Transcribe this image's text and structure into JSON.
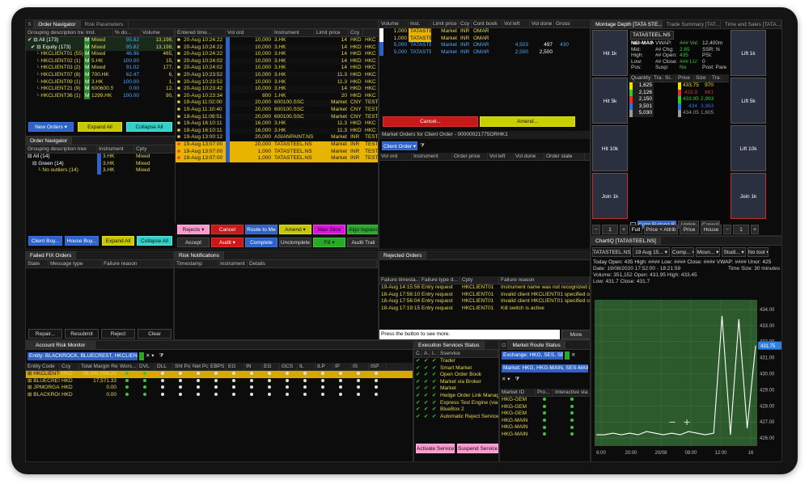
{
  "order_navigator": {
    "tabs": [
      "Order Navigator",
      "Risk Parameters"
    ],
    "tree_headers": [
      "Grouping description tree",
      "Inst.",
      "% do...",
      "Volume"
    ],
    "tree_rows": [
      {
        "label": "All (173)",
        "inst": "Mixed",
        "pct": "95.82",
        "vol": "13,198,"
      },
      {
        "label": "Equity (173)",
        "inst": "Mixed",
        "pct": "95.82",
        "vol": "13,198,"
      },
      {
        "label": "HKCLIENT01 (55)",
        "inst": "Mixed",
        "pct": "46.96",
        "vol": "465,"
      },
      {
        "label": "HKCLIENT02 (1)",
        "inst": "5.HK",
        "pct": "100.00",
        "vol": "15,"
      },
      {
        "label": "HKCLIENT03 (2)",
        "inst": "Mixed",
        "pct": "91.02",
        "vol": "177,"
      },
      {
        "label": "HKCLIENT07 (8)",
        "inst": "700.HK",
        "pct": "62.47",
        "vol": "6,"
      },
      {
        "label": "HKCLIENT09 (1)",
        "inst": "3.HK",
        "pct": "100.00",
        "vol": "1,"
      },
      {
        "label": "HKCLIENT21 (9)",
        "inst": "600600.SSC",
        "pct": "0.00",
        "vol": "12,"
      },
      {
        "label": "HKCLIENT36 (1)",
        "inst": "1299.HK",
        "pct": "100.00",
        "vol": "90,"
      }
    ],
    "order_headers": [
      "Entered time...",
      "Vol ord",
      "Instrument",
      "Limit price",
      "Ccy",
      ""
    ],
    "orders": [
      {
        "time": "20-Aug 10:24:22",
        "vol": "10,000",
        "inst": "3.HK",
        "price": "14",
        "ccy": "HKD",
        "x": "HKC",
        "tc": "#e6d84a",
        "hl": false
      },
      {
        "time": "20-Aug 10:24:22",
        "vol": "10,000",
        "inst": "3.HK",
        "price": "14",
        "ccy": "HKD",
        "x": "HKC",
        "tc": "#e6d84a",
        "hl": false
      },
      {
        "time": "20-Aug 10:24:22",
        "vol": "10,000",
        "inst": "3.HK",
        "price": "14",
        "ccy": "HKD",
        "x": "HKC",
        "tc": "#e6d84a",
        "hl": false
      },
      {
        "time": "20-Aug 10:24:02",
        "vol": "10,000",
        "inst": "3.HK",
        "price": "14",
        "ccy": "HKD",
        "x": "HKC",
        "tc": "#e6d84a",
        "hl": false
      },
      {
        "time": "20-Aug 10:24:02",
        "vol": "10,000",
        "inst": "3.HK",
        "price": "14",
        "ccy": "HKD",
        "x": "HKC",
        "tc": "#e6d84a",
        "hl": false
      },
      {
        "time": "20-Aug 10:23:52",
        "vol": "10,000",
        "inst": "3.HK",
        "price": "11.3",
        "ccy": "HKD",
        "x": "HKC",
        "tc": "#e6d84a",
        "hl": false
      },
      {
        "time": "20-Aug 10:23:52",
        "vol": "10,000",
        "inst": "3.HK",
        "price": "11.3",
        "ccy": "HKD",
        "x": "HKC",
        "tc": "#e6d84a",
        "hl": false
      },
      {
        "time": "20-Aug 10:23:42",
        "vol": "10,000",
        "inst": "3.HK",
        "price": "14",
        "ccy": "HKD",
        "x": "HKC",
        "tc": "#e6d84a",
        "hl": false
      },
      {
        "time": "20-Aug 10:23:34",
        "vol": "800",
        "inst": "1.HK",
        "price": "20",
        "ccy": "HKD",
        "x": "HKC",
        "tc": "#e6d84a",
        "hl": false
      },
      {
        "time": "19-Aug 11:02:00",
        "vol": "20,000",
        "inst": "600100.SSC",
        "price": "Market",
        "ccy": "CNY",
        "x": "TEST",
        "tc": "#e6d84a",
        "hl": false
      },
      {
        "time": "19-Aug 11:10:40",
        "vol": "20,000",
        "inst": "600100.SSC",
        "price": "Market",
        "ccy": "CNY",
        "x": "TEST",
        "tc": "#e6d84a",
        "hl": false
      },
      {
        "time": "19-Aug 11:09:51",
        "vol": "20,000",
        "inst": "600100.SSC",
        "price": "Market",
        "ccy": "CNY",
        "x": "TEST",
        "tc": "#e6d84a",
        "hl": false
      },
      {
        "time": "19-Aug 16:10:11",
        "vol": "16,000",
        "inst": "3.HK",
        "price": "11.3",
        "ccy": "HKD",
        "x": "HKC",
        "tc": "#e6d84a",
        "hl": false
      },
      {
        "time": "19-Aug 16:10:11",
        "vol": "16,000",
        "inst": "3.HK",
        "price": "11.3",
        "ccy": "HKD",
        "x": "HKC",
        "tc": "#e6d84a",
        "hl": false
      },
      {
        "time": "19-Aug 13:00:12",
        "vol": "20,000",
        "inst": "ASIANPAINT.NS",
        "price": "Market",
        "ccy": "INR",
        "x": "TEST",
        "tc": "#e6d84a",
        "hl": false
      },
      {
        "time": "19-Aug 13:07:00",
        "vol": "20,000",
        "inst": "TATASTEEL.NS",
        "price": "Market",
        "ccy": "INR",
        "x": "TEST",
        "tc": "#ffffff",
        "hl": true
      },
      {
        "time": "19-Aug 13:07:00",
        "vol": "1,000",
        "inst": "TATASTEEL.NS",
        "price": "Market",
        "ccy": "INR",
        "x": "TEST",
        "tc": "#ffffff",
        "hl": true
      },
      {
        "time": "19-Aug 13:07:00",
        "vol": "1,000",
        "inst": "TATASTEEL.NS",
        "price": "Market",
        "ccy": "INR",
        "x": "TEST",
        "tc": "#ffffff",
        "hl": true
      }
    ],
    "buttons": {
      "new_orders": "New Orders",
      "expand_all": "Expand All",
      "collapse_all": "Collapse All"
    },
    "actions_row1": [
      "Rejects",
      "Cancel",
      "Route to Me",
      "Amend",
      "Man Slice",
      "Algo bypass"
    ],
    "actions_row2": [
      "Accept",
      "Audit",
      "Complete",
      "Unclomplete",
      "Fill",
      "Audit Trail"
    ]
  },
  "order_navigator_2": {
    "tab": "Order Navigator",
    "headers": [
      "Grouping description tree",
      "Instrument",
      "Cpty"
    ],
    "rows": [
      {
        "label": "All (14)",
        "inst": "3.HK",
        "cpty": "Mixed"
      },
      {
        "label": "Green (14)",
        "inst": "3.HK",
        "cpty": "Mixed"
      },
      {
        "label": "No outliers (14)",
        "inst": "3.HK",
        "cpty": "Mixed"
      }
    ],
    "buttons": [
      "Client Buy...",
      "House Buy...",
      "Expand All",
      "Collapse All"
    ]
  },
  "market_orders": {
    "headers": [
      "Volume",
      "Inst.",
      "Limit price",
      "Ccy",
      "Cont book",
      "Vol left",
      "Vol done",
      "Gross"
    ],
    "rows": [
      {
        "vol": "1,000",
        "inst": "TATASTEEL",
        "price": "Market",
        "ccy": "INR",
        "book": "OMAR",
        "left": "",
        "done": "",
        "gross": ""
      },
      {
        "vol": "1,000",
        "inst": "TATASTEEL",
        "price": "Market",
        "ccy": "INR",
        "book": "OMAR",
        "left": "",
        "done": "",
        "gross": ""
      },
      {
        "vol": "5,000",
        "inst": "TATASTEEL",
        "price": "Market",
        "ccy": "INR",
        "book": "OMAR",
        "left": "4,503",
        "done": "497",
        "gross": "430"
      },
      {
        "vol": "5,000",
        "inst": "TATASTEEL",
        "price": "Market",
        "ccy": "INR",
        "book": "OMAR",
        "left": "2,500",
        "done": "2,500",
        "gross": ""
      }
    ],
    "cancel": "Cancel...",
    "amend": "Amend...",
    "client_title": "Market Orders for Client Order - 00000021775ORHK1",
    "client_order": "Client Order",
    "client_headers": [
      "Vol ord",
      "Instrument",
      "Order price",
      "Vol left",
      "Vol done",
      "Order state"
    ]
  },
  "failed_fix": {
    "tab": "Failed FIX Orders",
    "headers": [
      "State",
      "Message type",
      "Failure reason"
    ],
    "buttons": [
      "Repair...",
      "Resubmit",
      "Reject",
      "Clear"
    ]
  },
  "risk_notifications": {
    "tab": "Risk Notifications",
    "headers": [
      "Timestamp",
      "Instrument",
      "Details"
    ]
  },
  "rejected_orders": {
    "tab": "Rejected Orders",
    "headers": [
      "Failure timesta...",
      "Failure type d...",
      "Cpty",
      "Failure reason"
    ],
    "rows": [
      {
        "time": "19-Aug 14:15:56",
        "type": "Entry request",
        "cpty": "HKCLIENT01",
        "reason": "Instrument name was not recognized (no I"
      },
      {
        "time": "18-Aug 17:56:10",
        "type": "Entry request",
        "cpty": "HKCLIENT01",
        "reason": "Invalid client HKCLIENT01 specified on risk"
      },
      {
        "time": "18-Aug 17:56:04",
        "type": "Entry request",
        "cpty": "HKCLIENT01",
        "reason": "Invalid client HKCLIENT01 specified on risk"
      },
      {
        "time": "18-Aug 17:19:15",
        "type": "Entry request",
        "cpty": "HKCLIENT01",
        "reason": "Kill switch is active"
      }
    ],
    "footer": "Press the button to see more.",
    "more": "More"
  },
  "account_risk": {
    "tab": "Account Risk Monitor",
    "filter": "Entity: BLACKROCK, BLUECREST, HKCLIENT01, JPM...",
    "headers": [
      "Entity Code",
      "Ccy",
      "Total Margin Req",
      "Wors...",
      "DVL",
      "DLL",
      "Sht Pos",
      "Net Pos",
      "EBPS",
      "EG",
      "IN",
      "EG",
      "GCS",
      "IL",
      "ILP",
      "IP",
      "IS",
      "ISP"
    ],
    "rows": [
      {
        "code": "HKCLIENT01",
        "ccy": "HKD",
        "margin": "36,391,056.26"
      },
      {
        "code": "BLUECREST",
        "ccy": "HKD",
        "margin": "17,571.33"
      },
      {
        "code": "JPMORGAN",
        "ccy": "HKD",
        "margin": "0.00"
      },
      {
        "code": "BLACKROCK",
        "ccy": "HKD",
        "margin": "0.00"
      }
    ]
  },
  "exec_services": {
    "tab": "Execution Services Status",
    "headers": [
      "C..",
      "A..",
      "I..",
      "Sservice"
    ],
    "rows": [
      "Trader",
      "Smart Market",
      "Open Order Book",
      "Market via Broker",
      "Market",
      "Hedge Order Link Manag",
      "Express Test Engine (via )",
      "BlueBox 2",
      "Automatic Reject Service"
    ],
    "buttons": [
      "Activate Service",
      "Suspend Service"
    ]
  },
  "market_route": {
    "tab": "Market Route Status",
    "exchange": "Exchange: HKG, SES, SET",
    "market": "Market: HKG, HKG-MAIN, SES-MAIN, S...",
    "headers": [
      "Market ID",
      "Pro...",
      "Interactive sta"
    ],
    "rows": [
      "HKG-GEM",
      "HKG-GEM",
      "HKG-GEM",
      "HKG-MAIN",
      "HKG-MAIN",
      "HKG-MAIN"
    ]
  },
  "montage": {
    "tabs": [
      "Montage Depth [TATA STE...",
      "Trade Summary [TAT...",
      "Time and Sales [TATA..."
    ],
    "hit_buttons": [
      "Hit 1k",
      "Hit 5k",
      "Hit 10k",
      "Join 1k"
    ],
    "lift_buttons": [
      "Lift 1k",
      "Lift 5k",
      "Lift 10k",
      "Join 1k"
    ],
    "symbol": "TATASTEEL.NS",
    "venue": "NSI-MAIN",
    "quote_lines": [
      [
        "NSI-MAIN",
        "VWAP:",
        "### Vol:",
        "12,400m"
      ],
      [
        "Mid:",
        "## Chg:",
        "2.65",
        "SSR: N"
      ],
      [
        "High:",
        "## Open:",
        "435",
        "PSI:"
      ],
      [
        "Low:",
        "## Close:",
        "### LU:",
        "0"
      ],
      [
        "Pos:",
        "Susp:",
        "No",
        "Post: Panel"
      ]
    ],
    "depth_headers": [
      "Quantity",
      "Tra...",
      "Si..",
      "Price",
      "Size",
      "Tra"
    ],
    "bids": [
      "1,625",
      "2,126",
      "2,150",
      "3,501",
      "5,030"
    ],
    "asks": [
      [
        "433.75",
        "970"
      ],
      [
        "433.9",
        "861"
      ],
      [
        "433.95",
        "2,993"
      ],
      [
        "434",
        "3,963"
      ],
      [
        "434.05",
        "1,605"
      ]
    ],
    "bid_colors": [
      "#f0e000",
      "#2dc92d",
      "#e03030",
      "#3070e0",
      "#9a9a9a"
    ],
    "ask_colors": [
      "#f0e000",
      "#e03030",
      "#2dc92d",
      "#3070e0",
      "#9a9a9a"
    ],
    "furlong": "Colm.Furlong B...",
    "unlink": "Unlink",
    "cancel": "Cancel",
    "qty_minus": "−",
    "qty_val": "1",
    "qty_plus": "+",
    "footer_tabs": [
      "Full",
      "Price + Attrib",
      "Price",
      "House"
    ]
  },
  "chart": {
    "tab": "ChartIQ [TATASTEEL.NS]",
    "toolbar": [
      "TATASTEEL.NS",
      "19 Aug 15...",
      "Comp...",
      "Moun...",
      "Studi...",
      "No tool"
    ],
    "summary": "Today  Open: 435  High: ####  Low: ####  Close: ####  VWAP: ####  Unor: 425",
    "date_line": "Date: 19/08/2020 17:52:00 - 18:21:59",
    "ts": "Time Size: 30 minutes",
    "vol_line": "Volume: 351,152   Open: 431.95   High: 433.45",
    "low_line": "Low: 431.7   Close: 431.7",
    "last_label": "431.75",
    "zoom_minus": "−",
    "zoom_plus": "+"
  },
  "chart_data": {
    "type": "line",
    "x": [
      "6:00",
      "20:00",
      "20/08",
      "08:00",
      "12:00",
      "16"
    ],
    "values": [
      426.2,
      426.2,
      426.3,
      426.2,
      426.3,
      426.2,
      426.4,
      426.3,
      426.2,
      426.3,
      426.2,
      426.4,
      426.3,
      426.2,
      426.3,
      433.6,
      426.2,
      433.4,
      426.6,
      431.75
    ],
    "y_ticks": [
      "434.00",
      "433.00",
      "432.00",
      "431.00",
      "430.00",
      "429.00",
      "428.00",
      "427.00",
      "426.00"
    ],
    "ylim": [
      425.5,
      434.6
    ],
    "grid": true,
    "color": "#ffffff"
  }
}
